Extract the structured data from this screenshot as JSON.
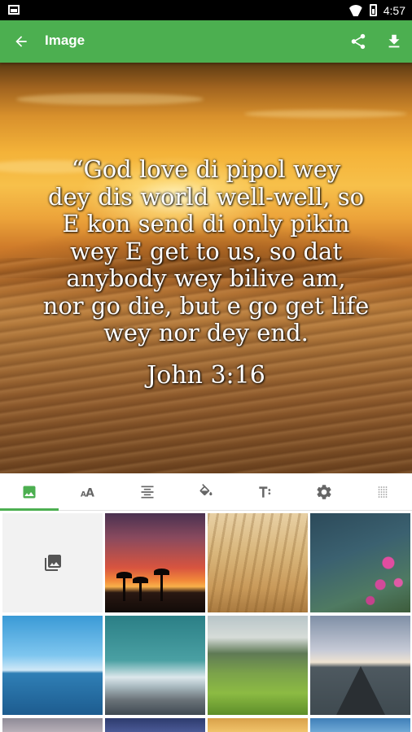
{
  "status_bar": {
    "time": "4:57"
  },
  "app_bar": {
    "title": "Image",
    "back_icon": "arrow-back-icon",
    "share_icon": "share-icon",
    "download_icon": "download-icon"
  },
  "preview": {
    "verse_lines": [
      "“God love di pipol wey",
      "dey dis world well-well, so",
      "E kon send di only pikin",
      "wey E get to us, so dat",
      "anybody wey bilive am,",
      "nor go die, but e go get life",
      "wey nor dey end."
    ],
    "reference": "John 3:16"
  },
  "tabs": [
    {
      "icon": "image-icon",
      "active": true
    },
    {
      "icon": "font-size-icon",
      "active": false
    },
    {
      "icon": "align-center-icon",
      "active": false
    },
    {
      "icon": "paint-bucket-icon",
      "active": false
    },
    {
      "icon": "text-style-icon",
      "active": false
    },
    {
      "icon": "settings-icon",
      "active": false
    },
    {
      "icon": "opacity-grid-icon",
      "active": false
    }
  ],
  "colors": {
    "app_bar": "#4caf50",
    "active_tab": "#4caf50"
  }
}
